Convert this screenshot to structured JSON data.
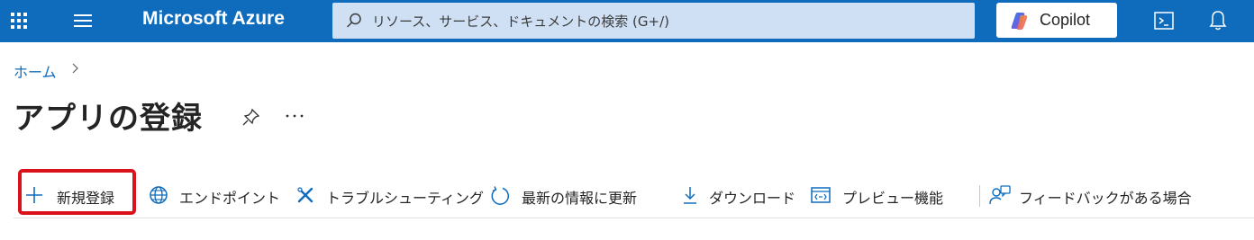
{
  "topbar": {
    "brand": "Microsoft Azure",
    "search_placeholder": "リソース、サービス、ドキュメントの検索 (G+/)",
    "copilot_label": "Copilot"
  },
  "breadcrumb": {
    "home": "ホーム"
  },
  "page": {
    "title": "アプリの登録"
  },
  "toolbar": {
    "items": [
      {
        "label": "新規登録",
        "icon": "plus-icon"
      },
      {
        "label": "エンドポイント",
        "icon": "globe-icon"
      },
      {
        "label": "トラブルシューティング",
        "icon": "wrench-icon"
      },
      {
        "label": "最新の情報に更新",
        "icon": "refresh-icon"
      },
      {
        "label": "ダウンロード",
        "icon": "download-icon"
      },
      {
        "label": "プレビュー機能",
        "icon": "preview-icon"
      },
      {
        "label": "フィードバックがある場合",
        "icon": "feedback-icon"
      }
    ]
  },
  "colors": {
    "topbar": "#0f6cbd",
    "search_bg": "#cfe0f5",
    "link": "#0f6cbd",
    "highlight": "#d9121b"
  }
}
